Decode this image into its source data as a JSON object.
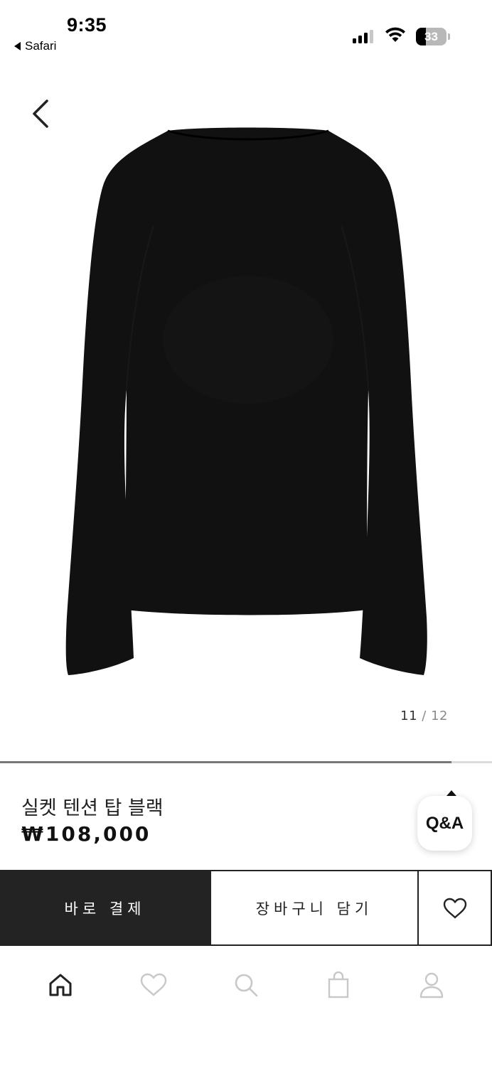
{
  "status_bar": {
    "time": "9:35",
    "back_app": "Safari",
    "battery_percent": "33",
    "battery_level": 0.33,
    "signal_bars_active": 3
  },
  "gallery": {
    "current": "11",
    "separator": "/",
    "total": "12",
    "progress_fraction": 0.917
  },
  "product": {
    "name": "실켓 텐션 탑 블랙",
    "price": "₩108,000",
    "image_icon": "black-long-sleeve-top-image"
  },
  "qa": {
    "label": "Q&A"
  },
  "actions": {
    "buy_now": "바로 결제",
    "add_to_cart": "장바구니 담기",
    "wishlist_icon": "heart-icon"
  },
  "tab_bar": {
    "items": [
      {
        "icon": "home-icon",
        "active": true
      },
      {
        "icon": "heart-icon",
        "active": false
      },
      {
        "icon": "search-icon",
        "active": false
      },
      {
        "icon": "bag-icon",
        "active": false
      },
      {
        "icon": "user-icon",
        "active": false
      }
    ]
  },
  "colors": {
    "accent": "#232323",
    "inactive_icon": "#c8c8c8",
    "progress": "#777777"
  }
}
